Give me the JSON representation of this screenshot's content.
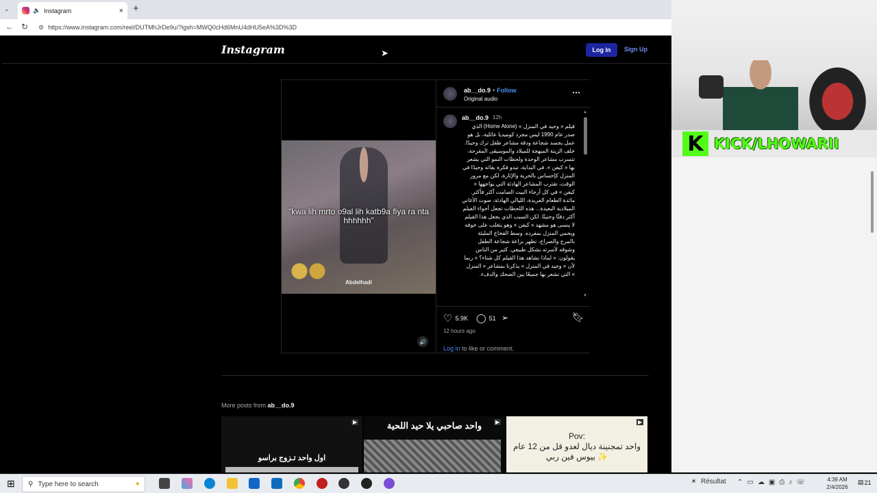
{
  "browser": {
    "tab_title": "Instagram",
    "new_tab": "+",
    "url": "https://www.instagram.com/reel/DUTMhJrDe9u/?igsh=MWQ0cHd6MnU4dHU5eA%3D%3D"
  },
  "instagram": {
    "logo": "Instagram",
    "login_label": "Log In",
    "signup_label": "Sign Up",
    "post": {
      "username": "ab__do.9",
      "follow_label": "Follow",
      "audio_label": "Original audio",
      "comment_username": "ab__do.9",
      "comment_age": "12h",
      "caption_text": "فيلم « وحيد في المنزل » (Home Alone) الذي صدر عام 1990 ليس مجرد كوميديا عائلية، بل هو عمل يجسد شجاعة ودقة مشاعر طفل ترك وحيدًا. خلف الزينة المبهجة للميلاد والموسيقى المفرحة، تتسرب مشاعر الوحدة ولحظات النمو التي يشعر بها « كيفن ». في البداية، تبدو فكرة بقائه وحيدًا في المنزل كإحساس بالحرية والإثارة، لكن مع مرور الوقت، تقترب المشاعر الهادئة التي يواجهها « كيفن » في كل أرجاء البيت الصامت أكثر فأكثر. مائدة الطعام الفريدة، الليالي الهادئة، صوت الأغاني الميلادية البعيدة... هذه اللحظات تجعل أجواء الفيلم أكثر دفئًا وحنينًا. لكن السبب الذي يجعل هذا الفيلم لا ينسى هو مشهد « كيفن » وهو يتغلب على خوفه ويحمي المنزل بمفرده. وسط الفخاخ المليئة بالمرح والصراخ، تظهر براعة شجاعة الطفل وشوقه لأسرته بشكل طبيعي. كثير من الناس يقولون: « لماذا نشاهد هذا الفيلم كل شتاء؟ » ربما لأن « وحيد في المنزل » يذكرنا بمشاعر « المنزل » التي نشعر بها جميعًا بين الضحك والدفء.",
      "video_caption": "\"kwa lih mrto o9al lih katb9a fiya ra nta hhhhhh\"",
      "video_watermark": "Abdelhadi",
      "likes": "5.9K",
      "comments": "51",
      "time_ago": "12 hours ago",
      "login_link": "Log in",
      "login_suffix": " to like or comment."
    },
    "more_posts": {
      "prefix": "More posts from ",
      "username": "ab__do.9",
      "thumbs": [
        {
          "text": "اول واحد تـزوج براسو"
        },
        {
          "text": "واحد صاحبي يلا حيد اللحية"
        },
        {
          "text": "Pov:\nواحد تمجنينة ديال لعدو قل من 12 عام بيوس فين ربي ✨"
        }
      ]
    }
  },
  "stream": {
    "kick_label": "KICK/LHOWARII",
    "colors": {
      "kick_green": "#53fc18"
    }
  },
  "taskbar": {
    "search_placeholder": "Type here to search",
    "weather_label": "Résultat",
    "time": "4:39 AM",
    "date": "2/4/2026",
    "notifications": "21"
  }
}
